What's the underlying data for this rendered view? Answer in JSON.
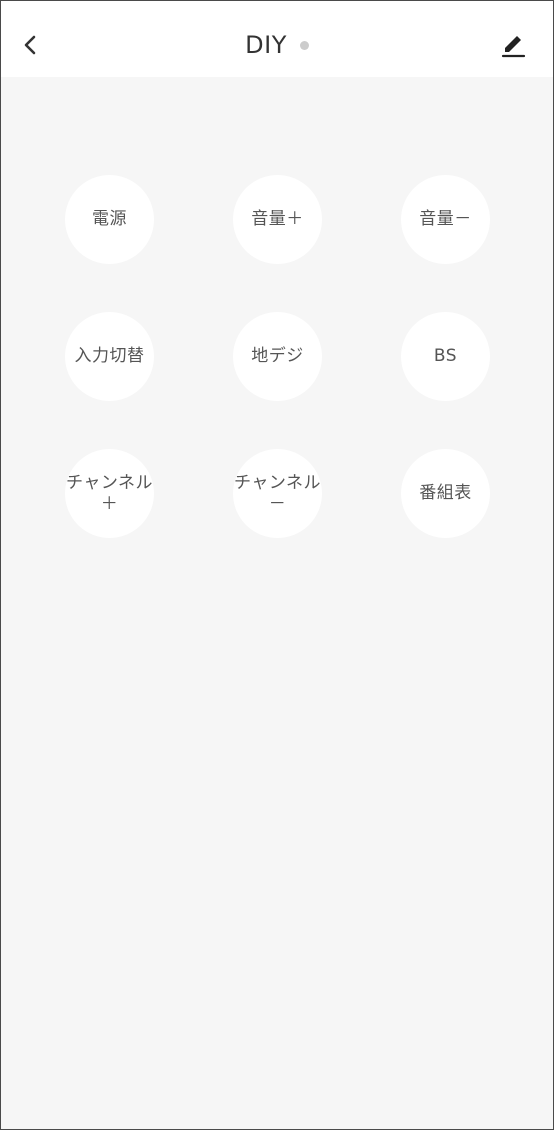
{
  "header": {
    "title": "DIY",
    "back_icon": "chevron-left-icon",
    "edit_icon": "pencil-icon",
    "status_dot_color": "#cccccc"
  },
  "colors": {
    "background": "#f6f6f6",
    "header_background": "#ffffff",
    "key_background": "#ffffff",
    "label_color": "#555555"
  },
  "remote": {
    "keys": [
      {
        "label": "電源"
      },
      {
        "label": "音量＋"
      },
      {
        "label": "音量－"
      },
      {
        "label": "入力切替"
      },
      {
        "label": "地デジ"
      },
      {
        "label": "BS"
      },
      {
        "label": "チャンネル\n＋"
      },
      {
        "label": "チャンネル\n－"
      },
      {
        "label": "番組表"
      }
    ]
  }
}
